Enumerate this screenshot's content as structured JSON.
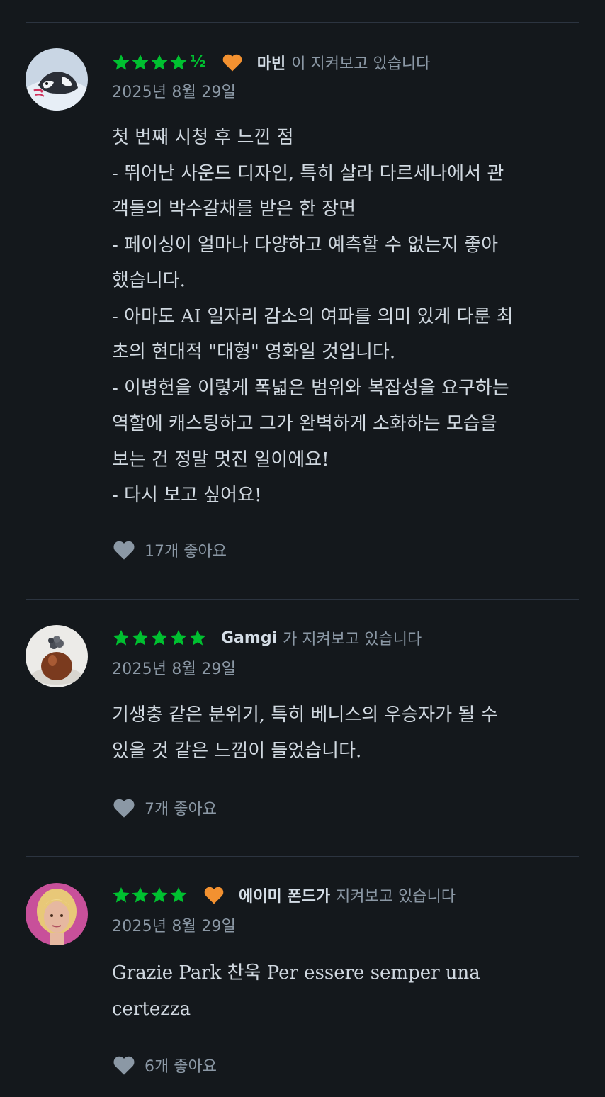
{
  "colors": {
    "background": "#14181c",
    "star_green": "#00c030",
    "heart_orange": "#f39130",
    "muted_text": "#8b98a5"
  },
  "reviews": [
    {
      "rating": 4.5,
      "rating_half_glyph": "½",
      "liked": true,
      "author": "마빈",
      "watched_text": "이 지켜보고 있습니다",
      "date": "2025년 8월 29일",
      "lines": [
        "첫 번째 시청 후 느낀 점",
        "- 뛰어난 사운드 디자인, 특히 살라 다르세나에서 관",
        "객들의 박수갈채를 받은 한 장면",
        "- 페이싱이 얼마나 다양하고 예측할 수 없는지 좋아",
        "했습니다.",
        "- 아마도 AI 일자리 감소의 여파를 의미 있게 다룬 최",
        "초의 현대적 \"대형\" 영화일 것입니다.",
        "- 이병헌을 이렇게 폭넓은 범위와 복잡성을 요구하는",
        "역할에 캐스팅하고 그가 완벽하게 소화하는 모습을",
        "보는 건 정말 멋진 일이에요!",
        "- 다시 보고 싶어요!"
      ],
      "likes_label": "17개 좋아요",
      "avatar_icon": "husky-dog-avatar"
    },
    {
      "rating": 5,
      "liked": false,
      "author": "Gamgi",
      "watched_text": "가 지켜보고 있습니다",
      "date": "2025년 8월 29일",
      "lines": [
        "기생충 같은 분위기, 특히 베니스의 우승자가 될 수",
        "있을 것 같은 느낌이 들었습니다."
      ],
      "likes_label": "7개 좋아요",
      "avatar_icon": "dessert-avatar"
    },
    {
      "rating": 4,
      "liked": true,
      "author": "에이미 폰드가",
      "watched_text": "지켜보고 있습니다",
      "date": "2025년 8월 29일",
      "lines": [
        "Grazie Park 찬욱 Per essere semper una",
        "certezza"
      ],
      "likes_label": "6개 좋아요",
      "avatar_icon": "blonde-woman-avatar"
    }
  ]
}
